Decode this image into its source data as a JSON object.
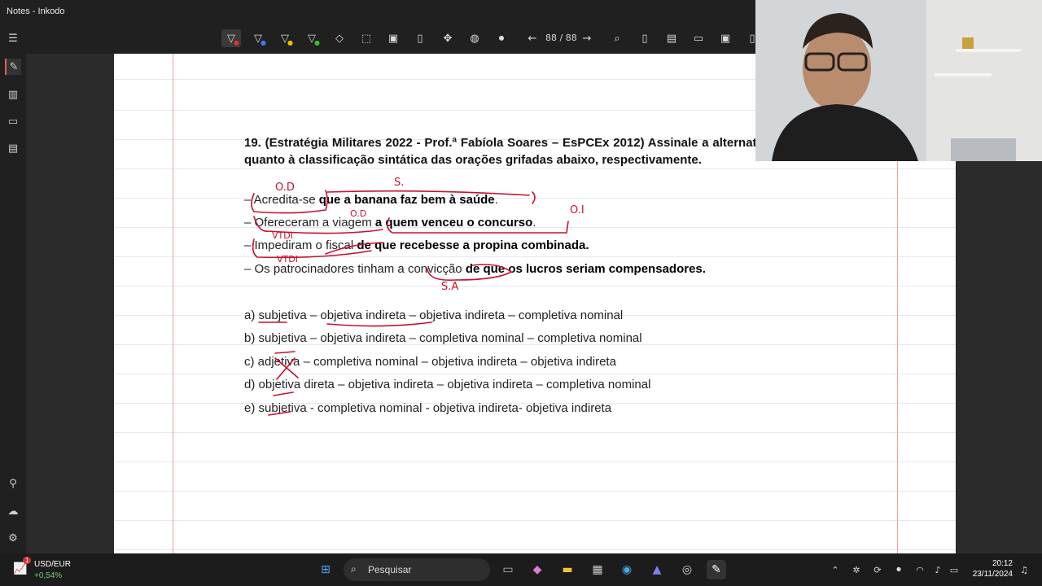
{
  "window": {
    "title": "Notes - Inkodo"
  },
  "toolbar": {
    "page_counter": "88 / 88"
  },
  "question": {
    "title": "19. (Estratégia Militares 2022 - Prof.ª Fabíola Soares – EsPCEx 2012) Assinale a alternativa correta quanto à classificação sintática das orações grifadas abaixo, respectivamente.",
    "sentences": [
      {
        "plain": "– Acredita-se ",
        "bold": "que a banana faz bem à saúde",
        "tail": "."
      },
      {
        "plain": "– Ofereceram a viagem ",
        "bold": "a quem venceu o concurso",
        "tail": "."
      },
      {
        "plain": "– Impediram o fiscal ",
        "bold": "de que recebesse a propina combinada.",
        "tail": ""
      },
      {
        "plain": "– Os patrocinadores tinham a convicção ",
        "bold": "de que os lucros seriam compensadores.",
        "tail": ""
      }
    ],
    "options": [
      "a) subjetiva – objetiva indireta – objetiva indireta – completiva nominal",
      "b) subjetiva – objetiva indireta – completiva nominal – completiva nominal",
      "c) adjetiva – completiva nominal – objetiva indireta – objetiva indireta",
      "d) objetiva direta – objetiva indireta – objetiva indireta – completiva nominal",
      "e) subjetiva - completiva nominal - objetiva indireta- objetiva indireta"
    ]
  },
  "annotations": {
    "s1_top": "O.D",
    "s1_right": "S.",
    "s2_top": "O.D",
    "s2_right": "O.I",
    "s3_top": "VTDI",
    "s3_bottom": "VTDI",
    "s4_bottom": "S.A"
  },
  "taskbar": {
    "ticker_label": "USD/EUR",
    "ticker_value": "+0,54%",
    "ticker_badge": "1",
    "search_placeholder": "Pesquisar",
    "time": "20:12",
    "date": "23/11/2024"
  },
  "colors": {
    "ink": "#c8102e",
    "margin_line": "#f0a0a0",
    "page_bg": "#ffffff"
  }
}
